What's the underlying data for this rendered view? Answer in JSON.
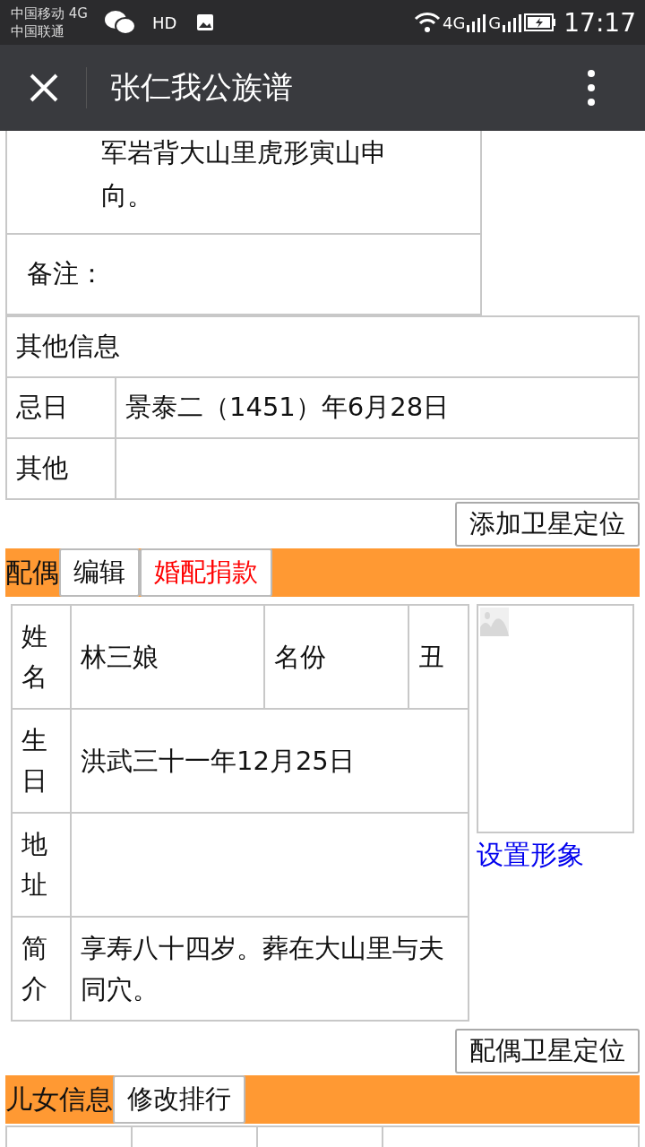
{
  "status_bar": {
    "carriers": [
      "中国移动 4G",
      "中国联通"
    ],
    "hd": "HD",
    "network_1": "4G",
    "network_2": "G",
    "time": "17:17"
  },
  "app_bar": {
    "title": "张仁我公族谱"
  },
  "burial_table": {
    "value": "军岩背大山里虎形寅山申向。",
    "note_label": "备注："
  },
  "other_info": {
    "title": "其他信息",
    "rows": [
      {
        "label": "忌日",
        "value": "景泰二（1451）年6月28日"
      },
      {
        "label": "其他"
      }
    ]
  },
  "satellite_button": "添加卫星定位",
  "spouse_section": {
    "title": "配偶",
    "buttons": [
      {
        "label": "编辑",
        "kind": "normal"
      },
      {
        "label": "婚配捐款",
        "kind": "donate"
      }
    ]
  },
  "spouse_table": {
    "name_label": "姓名",
    "name": "林三娘",
    "role_label": "名份",
    "role": "丑",
    "rows": [
      {
        "label": "生日",
        "value": "洪武三十一年12月25日"
      },
      {
        "label": "地址"
      },
      {
        "label": "简介",
        "value": "享寿八十四岁。葬在大山里与夫同穴。"
      }
    ]
  },
  "photo_link": "设置形象",
  "spouse_satellite_button": "配偶卫星定位",
  "children_section": {
    "title": "儿女信息",
    "buttons": [
      "修改排行"
    ]
  }
}
